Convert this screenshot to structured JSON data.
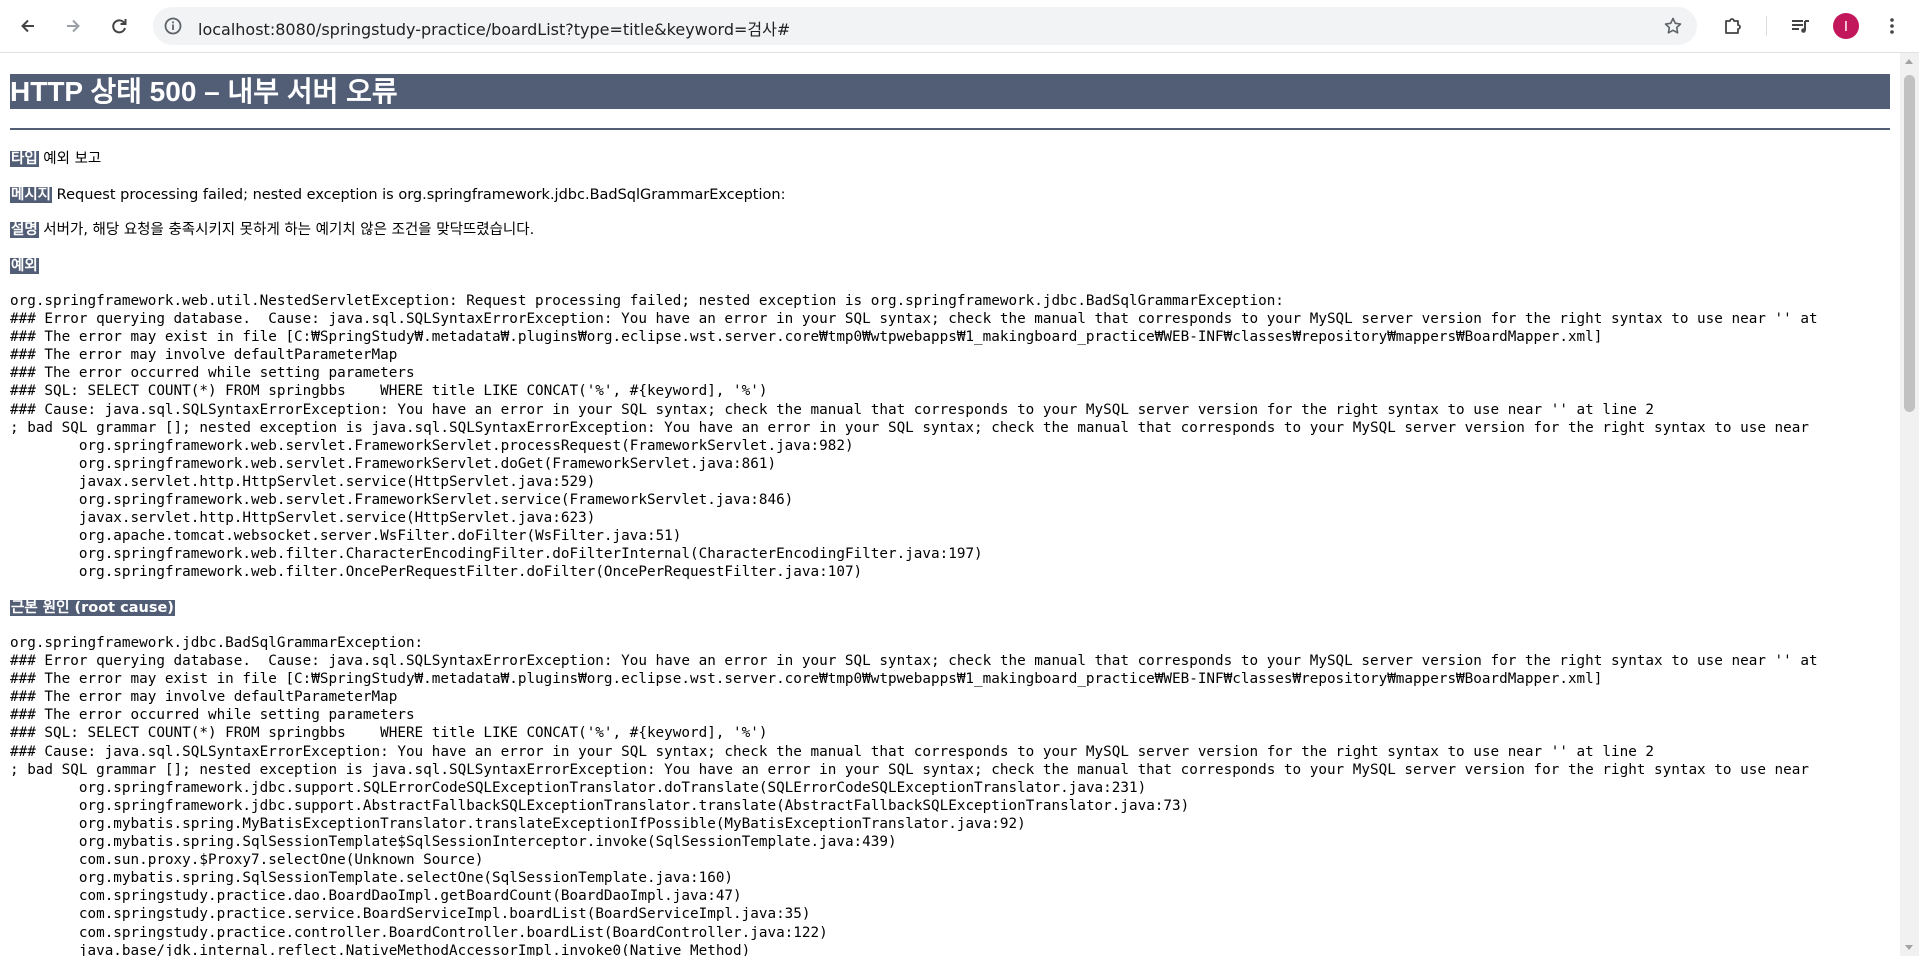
{
  "browser": {
    "url": "localhost:8080/springstudy-practice/boardList?type=title&keyword=검사#",
    "avatar_initial": "I",
    "avatar_color": "#c2185b"
  },
  "error_page": {
    "title": "HTTP 상태 500 – 내부 서버 오류",
    "accent_color": "#525d76",
    "type_label": "타입",
    "type_value": "예외 보고",
    "message_label": "메시지",
    "message_value": "Request processing failed; nested exception is org.springframework.jdbc.BadSqlGrammarException:",
    "description_label": "설명",
    "description_value": "서버가, 해당 요청을 충족시키지 못하게 하는 예기치 않은 조건을 맞닥뜨렸습니다.",
    "exception_label": "예외",
    "exception_trace": "org.springframework.web.util.NestedServletException: Request processing failed; nested exception is org.springframework.jdbc.BadSqlGrammarException: \n### Error querying database.  Cause: java.sql.SQLSyntaxErrorException: You have an error in your SQL syntax; check the manual that corresponds to your MySQL server version for the right syntax to use near '' at\n### The error may exist in file [C:₩SpringStudy₩.metadata₩.plugins₩org.eclipse.wst.server.core₩tmp0₩wtpwebapps₩1_makingboard_practice₩WEB-INF₩classes₩repository₩mappers₩BoardMapper.xml]\n### The error may involve defaultParameterMap\n### The error occurred while setting parameters\n### SQL: SELECT COUNT(*) FROM springbbs    WHERE title LIKE CONCAT('%', #{keyword], '%')\n### Cause: java.sql.SQLSyntaxErrorException: You have an error in your SQL syntax; check the manual that corresponds to your MySQL server version for the right syntax to use near '' at line 2\n; bad SQL grammar []; nested exception is java.sql.SQLSyntaxErrorException: You have an error in your SQL syntax; check the manual that corresponds to your MySQL server version for the right syntax to use near\n\torg.springframework.web.servlet.FrameworkServlet.processRequest(FrameworkServlet.java:982)\n\torg.springframework.web.servlet.FrameworkServlet.doGet(FrameworkServlet.java:861)\n\tjavax.servlet.http.HttpServlet.service(HttpServlet.java:529)\n\torg.springframework.web.servlet.FrameworkServlet.service(FrameworkServlet.java:846)\n\tjavax.servlet.http.HttpServlet.service(HttpServlet.java:623)\n\torg.apache.tomcat.websocket.server.WsFilter.doFilter(WsFilter.java:51)\n\torg.springframework.web.filter.CharacterEncodingFilter.doFilterInternal(CharacterEncodingFilter.java:197)\n\torg.springframework.web.filter.OncePerRequestFilter.doFilter(OncePerRequestFilter.java:107)",
    "root_cause_label": "근본 원인 (root cause)",
    "root_cause_trace": "org.springframework.jdbc.BadSqlGrammarException: \n### Error querying database.  Cause: java.sql.SQLSyntaxErrorException: You have an error in your SQL syntax; check the manual that corresponds to your MySQL server version for the right syntax to use near '' at\n### The error may exist in file [C:₩SpringStudy₩.metadata₩.plugins₩org.eclipse.wst.server.core₩tmp0₩wtpwebapps₩1_makingboard_practice₩WEB-INF₩classes₩repository₩mappers₩BoardMapper.xml]\n### The error may involve defaultParameterMap\n### The error occurred while setting parameters\n### SQL: SELECT COUNT(*) FROM springbbs    WHERE title LIKE CONCAT('%', #{keyword], '%')\n### Cause: java.sql.SQLSyntaxErrorException: You have an error in your SQL syntax; check the manual that corresponds to your MySQL server version for the right syntax to use near '' at line 2\n; bad SQL grammar []; nested exception is java.sql.SQLSyntaxErrorException: You have an error in your SQL syntax; check the manual that corresponds to your MySQL server version for the right syntax to use near\n\torg.springframework.jdbc.support.SQLErrorCodeSQLExceptionTranslator.doTranslate(SQLErrorCodeSQLExceptionTranslator.java:231)\n\torg.springframework.jdbc.support.AbstractFallbackSQLExceptionTranslator.translate(AbstractFallbackSQLExceptionTranslator.java:73)\n\torg.mybatis.spring.MyBatisExceptionTranslator.translateExceptionIfPossible(MyBatisExceptionTranslator.java:92)\n\torg.mybatis.spring.SqlSessionTemplate$SqlSessionInterceptor.invoke(SqlSessionTemplate.java:439)\n\tcom.sun.proxy.$Proxy7.selectOne(Unknown Source)\n\torg.mybatis.spring.SqlSessionTemplate.selectOne(SqlSessionTemplate.java:160)\n\tcom.springstudy.practice.dao.BoardDaoImpl.getBoardCount(BoardDaoImpl.java:47)\n\tcom.springstudy.practice.service.BoardServiceImpl.boardList(BoardServiceImpl.java:35)\n\tcom.springstudy.practice.controller.BoardController.boardList(BoardController.java:122)\n\tjava.base/jdk.internal.reflect.NativeMethodAccessorImpl.invoke0(Native Method)"
  }
}
